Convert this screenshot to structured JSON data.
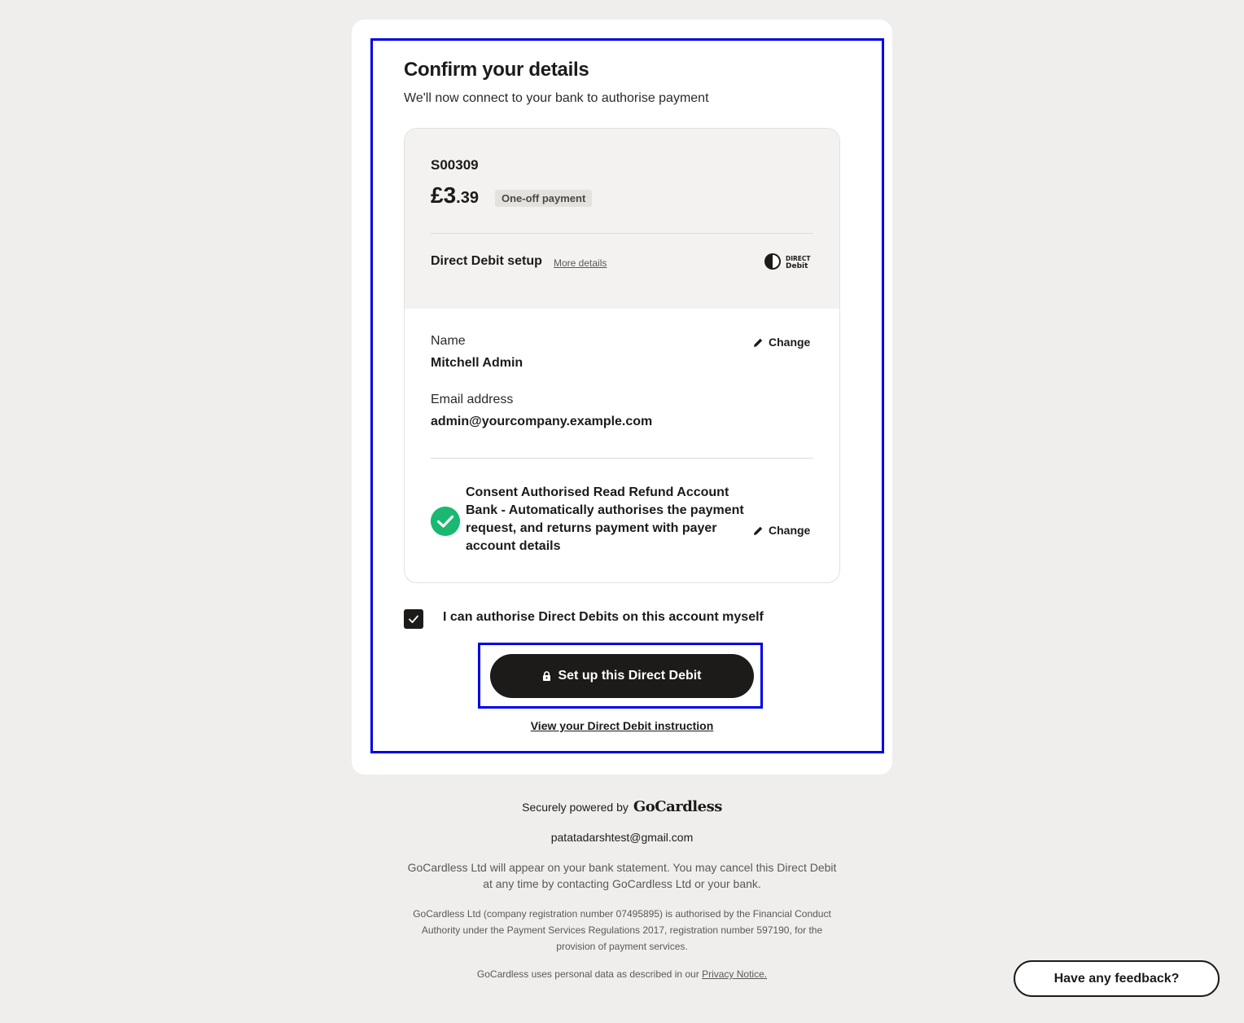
{
  "page": {
    "title": "Confirm your details",
    "subtitle": "We'll now connect to your bank to authorise payment"
  },
  "summary": {
    "reference": "S00309",
    "currency_symbol": "£",
    "amount_whole": "3",
    "amount_decimal": ".39",
    "payment_type_badge": "One-off payment",
    "setup_label": "Direct Debit setup",
    "more_details_link": "More details",
    "logo_icon": "direct-debit-logo",
    "logo_text_top": "DIRECT",
    "logo_text_bottom": "Debit"
  },
  "payer": {
    "name_label": "Name",
    "name_value": "Mitchell Admin",
    "email_label": "Email address",
    "email_value": "admin@yourcompany.example.com",
    "change_label": "Change"
  },
  "bank": {
    "status_icon": "check-circle-icon",
    "description": "Consent Authorised Read Refund Account Bank - Automatically authorises the payment request, and returns payment with payer account details",
    "change_label": "Change"
  },
  "authorise": {
    "checked": true,
    "label": "I can authorise Direct Debits on this account myself"
  },
  "actions": {
    "submit_label": "Set up this Direct Debit",
    "view_instruction_link": "View your Direct Debit instruction"
  },
  "footer": {
    "powered_by": "Securely powered by",
    "brand": "GoCardless",
    "contact_email": "patatadarshtest@gmail.com",
    "statement_note": "GoCardless Ltd will appear on your bank statement. You may cancel this Direct Debit at any time by contacting GoCardless Ltd or your bank.",
    "fca_note": "GoCardless Ltd (company registration number 07495895) is authorised by the Financial Conduct Authority under the Payment Services Regulations 2017, registration number 597190, for the provision of payment services.",
    "privacy_prefix": "GoCardless uses personal data as described in our",
    "privacy_link": "Privacy Notice."
  },
  "feedback": {
    "label": "Have any feedback?"
  },
  "colors": {
    "accent_outline": "#0000e6",
    "success": "#1ab871",
    "primary_button": "#1c1b19",
    "background": "#efeeec"
  }
}
